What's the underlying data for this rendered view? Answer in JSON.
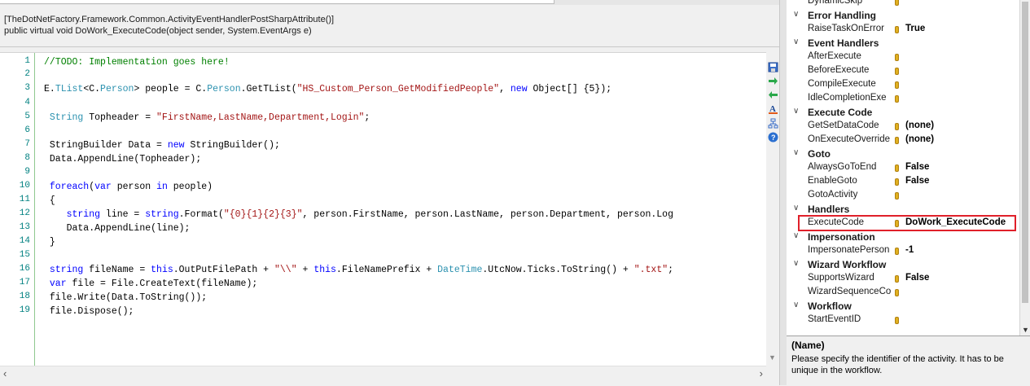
{
  "code_header": {
    "attribute_line": "[TheDotNetFactory.Framework.Common.ActivityEventHandlerPostSharpAttribute()]",
    "signature_line": "public virtual void DoWork_ExecuteCode(object sender, System.EventArgs e)"
  },
  "editor": {
    "line_numbers": [
      "1",
      "2",
      "3",
      "4",
      "5",
      "6",
      "7",
      "8",
      "9",
      "10",
      "11",
      "12",
      "13",
      "14",
      "15",
      "16",
      "17",
      "18",
      "19"
    ],
    "lines": [
      [
        {
          "t": "//TODO: Implementation goes here!",
          "c": "com"
        }
      ],
      [],
      [
        {
          "t": "E.",
          "c": "txt"
        },
        {
          "t": "TList",
          "c": "ty"
        },
        {
          "t": "<C.",
          "c": "txt"
        },
        {
          "t": "Person",
          "c": "ty"
        },
        {
          "t": "> people = C.",
          "c": "txt"
        },
        {
          "t": "Person",
          "c": "ty"
        },
        {
          "t": ".GetTList(",
          "c": "txt"
        },
        {
          "t": "\"HS_Custom_Person_GetModifiedPeople\"",
          "c": "str"
        },
        {
          "t": ", ",
          "c": "txt"
        },
        {
          "t": "new",
          "c": "kw"
        },
        {
          "t": " Object[] {5});",
          "c": "txt"
        }
      ],
      [],
      [
        {
          "t": " String",
          "c": "ty"
        },
        {
          "t": " Topheader = ",
          "c": "txt"
        },
        {
          "t": "\"FirstName,LastName,Department,Login\"",
          "c": "str"
        },
        {
          "t": ";",
          "c": "txt"
        }
      ],
      [],
      [
        {
          "t": " StringBuilder Data = ",
          "c": "txt"
        },
        {
          "t": "new",
          "c": "kw"
        },
        {
          "t": " StringBuilder();",
          "c": "txt"
        }
      ],
      [
        {
          "t": " Data.AppendLine(Topheader);",
          "c": "txt"
        }
      ],
      [],
      [
        {
          "t": " foreach",
          "c": "kw"
        },
        {
          "t": "(",
          "c": "txt"
        },
        {
          "t": "var",
          "c": "kw"
        },
        {
          "t": " person ",
          "c": "txt"
        },
        {
          "t": "in",
          "c": "kw"
        },
        {
          "t": " people)",
          "c": "txt"
        }
      ],
      [
        {
          "t": " {",
          "c": "txt"
        }
      ],
      [
        {
          "t": "    string",
          "c": "kw"
        },
        {
          "t": " line = ",
          "c": "txt"
        },
        {
          "t": "string",
          "c": "kw"
        },
        {
          "t": ".Format(",
          "c": "txt"
        },
        {
          "t": "\"{0}{1}{2}{3}\"",
          "c": "str"
        },
        {
          "t": ", person.FirstName, person.LastName, person.Department, person.Log",
          "c": "txt"
        }
      ],
      [
        {
          "t": "    Data.AppendLine(line);",
          "c": "txt"
        }
      ],
      [
        {
          "t": " }",
          "c": "txt"
        }
      ],
      [],
      [
        {
          "t": " string",
          "c": "kw"
        },
        {
          "t": " fileName = ",
          "c": "txt"
        },
        {
          "t": "this",
          "c": "kw"
        },
        {
          "t": ".OutPutFilePath + ",
          "c": "txt"
        },
        {
          "t": "\"\\\\\"",
          "c": "str"
        },
        {
          "t": " + ",
          "c": "txt"
        },
        {
          "t": "this",
          "c": "kw"
        },
        {
          "t": ".FileNamePrefix + ",
          "c": "txt"
        },
        {
          "t": "DateTime",
          "c": "ty"
        },
        {
          "t": ".UtcNow.Ticks.ToString() + ",
          "c": "txt"
        },
        {
          "t": "\".txt\"",
          "c": "str"
        },
        {
          "t": ";",
          "c": "txt"
        }
      ],
      [
        {
          "t": " var",
          "c": "kw"
        },
        {
          "t": " file = File.CreateText(fileName);",
          "c": "txt"
        }
      ],
      [
        {
          "t": " file.Write(Data.ToString());",
          "c": "txt"
        }
      ],
      [
        {
          "t": " file.Dispose();",
          "c": "txt"
        }
      ]
    ]
  },
  "side_buttons": [
    "save-icon",
    "go-forward-icon",
    "go-back-icon",
    "font-icon",
    "hierarchy-icon",
    "help-icon"
  ],
  "colors": {
    "comment": "#008000",
    "keyword": "#0000ff",
    "type": "#2b91af",
    "string": "#a31515",
    "highlight_border": "#e0202a",
    "gutter_line": "#90c890"
  },
  "property_grid": {
    "rows": [
      {
        "kind": "item",
        "name": "DynamicSkip",
        "value": ""
      },
      {
        "kind": "cat",
        "name": "Error Handling"
      },
      {
        "kind": "item",
        "name": "RaiseTaskOnError",
        "value": "True"
      },
      {
        "kind": "cat",
        "name": "Event Handlers"
      },
      {
        "kind": "item",
        "name": "AfterExecute",
        "value": ""
      },
      {
        "kind": "item",
        "name": "BeforeExecute",
        "value": ""
      },
      {
        "kind": "item",
        "name": "CompileExecute",
        "value": ""
      },
      {
        "kind": "item",
        "name": "IdleCompletionExe",
        "value": ""
      },
      {
        "kind": "cat",
        "name": "Execute Code"
      },
      {
        "kind": "item",
        "name": "GetSetDataCode",
        "value": "(none)"
      },
      {
        "kind": "item",
        "name": "OnExecuteOverride",
        "value": "(none)"
      },
      {
        "kind": "cat",
        "name": "Goto"
      },
      {
        "kind": "item",
        "name": "AlwaysGoToEnd",
        "value": "False"
      },
      {
        "kind": "item",
        "name": "EnableGoto",
        "value": "False"
      },
      {
        "kind": "item",
        "name": "GotoActivity",
        "value": ""
      },
      {
        "kind": "cat",
        "name": "Handlers"
      },
      {
        "kind": "item",
        "name": "ExecuteCode",
        "value": "DoWork_ExecuteCode"
      },
      {
        "kind": "cat",
        "name": "Impersonation"
      },
      {
        "kind": "item",
        "name": "ImpersonatePerson",
        "value": "-1"
      },
      {
        "kind": "cat",
        "name": "Wizard Workflow"
      },
      {
        "kind": "item",
        "name": "SupportsWizard",
        "value": "False"
      },
      {
        "kind": "item",
        "name": "WizardSequenceCo",
        "value": ""
      },
      {
        "kind": "cat",
        "name": "Workflow"
      },
      {
        "kind": "item",
        "name": "StartEventID",
        "value": ""
      }
    ]
  },
  "description": {
    "title": "(Name)",
    "text": "Please specify the identifier of the activity. It has to be unique in the workflow."
  }
}
